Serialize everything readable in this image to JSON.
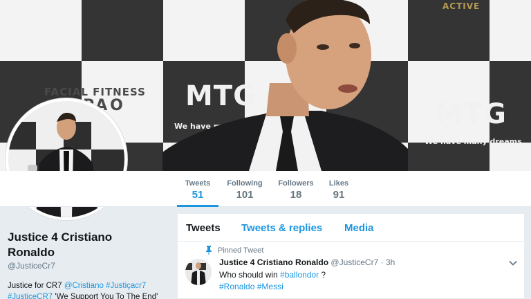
{
  "header": {
    "sponsor_top_left": "FACIAL FITNESS",
    "sponsor_pao": "PAO",
    "sponsor_mtg": "MTG",
    "sponsor_tagline": "We have many dreams",
    "sponsor_active": "ACTIVE"
  },
  "nav": {
    "stats": [
      {
        "label": "Tweets",
        "value": "51"
      },
      {
        "label": "Following",
        "value": "101"
      },
      {
        "label": "Followers",
        "value": "18"
      },
      {
        "label": "Likes",
        "value": "91"
      }
    ]
  },
  "profile": {
    "name": "Justice 4 Cristiano Ronaldo",
    "handle": "@JusticeCr7",
    "bio_start": "Justice for CR7 ",
    "bio_link1": "@Cristiano",
    "bio_link2": "#Justiçacr7",
    "bio_link3": "#JusticeCR7",
    "bio_end": " 'We Support You To The End'"
  },
  "timeline": {
    "tabs": [
      "Tweets",
      "Tweets & replies",
      "Media"
    ],
    "tweet": {
      "pinned_label": "Pinned Tweet",
      "author_name": "Justice 4 Cristiano Ronaldo",
      "author_handle": "@JusticeCr7",
      "separator": " · ",
      "time": "3h",
      "text_start": "Who should win ",
      "text_link": "#ballondor",
      "text_end": " ?",
      "hashtag1": "#Ronaldo",
      "hashtag2": "#Messi"
    }
  },
  "colors": {
    "accent": "#1b95e0",
    "background": "#e6ecf0",
    "muted_text": "#657786"
  }
}
